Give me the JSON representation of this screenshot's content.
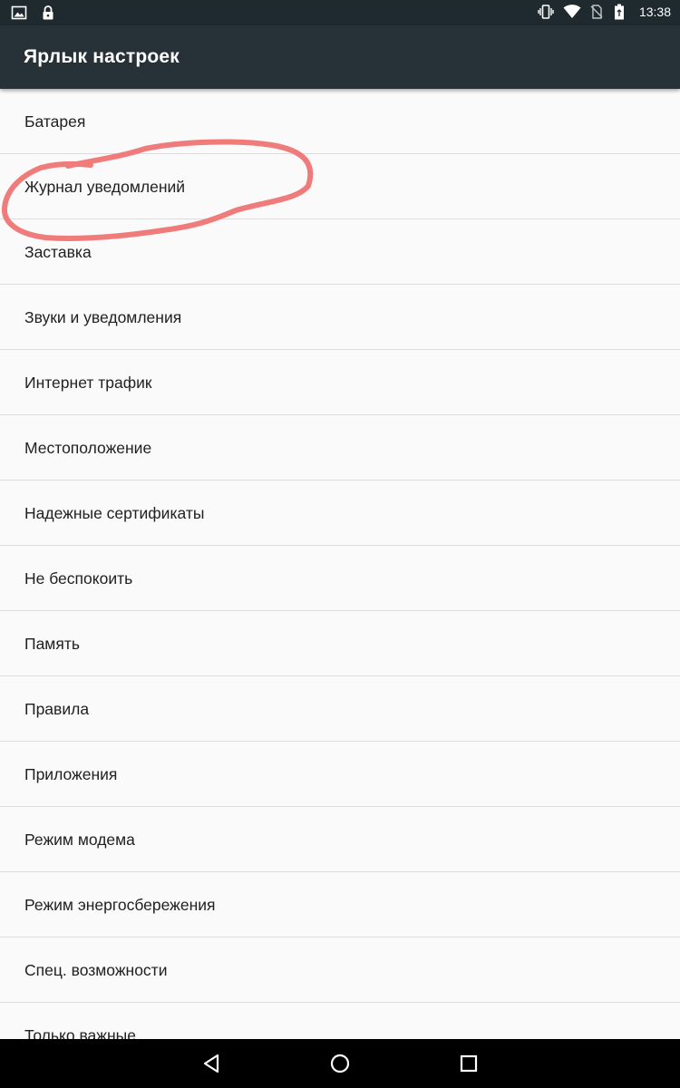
{
  "status_bar": {
    "time": "13:38",
    "icons_left": [
      "image-icon",
      "lock-icon"
    ],
    "icons_right": [
      "vibrate-icon",
      "wifi-icon",
      "no-sim-icon",
      "battery-icon"
    ]
  },
  "app_bar": {
    "title": "Ярлык настроек"
  },
  "settings": {
    "items": [
      {
        "label": "Батарея"
      },
      {
        "label": "Журнал уведомлений"
      },
      {
        "label": "Заставка"
      },
      {
        "label": "Звуки и уведомления"
      },
      {
        "label": "Интернет трафик"
      },
      {
        "label": "Местоположение"
      },
      {
        "label": "Надежные сертификаты"
      },
      {
        "label": "Не беспокоить"
      },
      {
        "label": "Память"
      },
      {
        "label": "Правила"
      },
      {
        "label": "Приложения"
      },
      {
        "label": "Режим модема"
      },
      {
        "label": "Режим энергосбережения"
      },
      {
        "label": "Спец. возможности"
      },
      {
        "label": "Только важные"
      }
    ]
  },
  "annotation": {
    "color": "#f07b7b",
    "target_item": "Журнал уведомлений"
  },
  "nav_bar": {
    "buttons": [
      "back-icon",
      "home-icon",
      "recents-icon"
    ]
  },
  "colors": {
    "status_bar": "#1f2a2f",
    "app_bar": "#263238",
    "background": "#fafafa",
    "divider": "#dcdcdc",
    "text": "#212121"
  }
}
